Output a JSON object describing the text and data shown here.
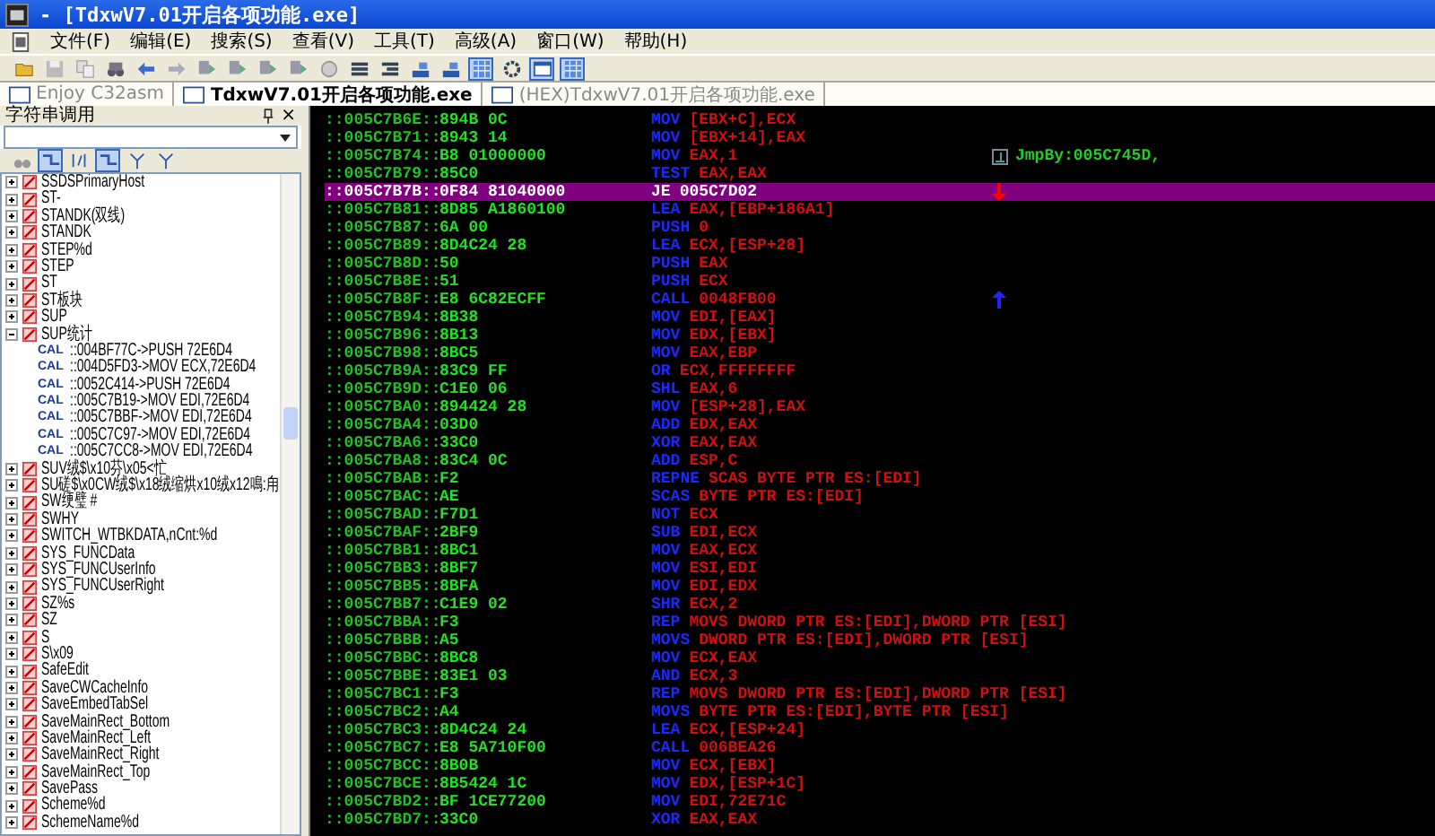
{
  "window": {
    "title": "- [TdxwV7.01开启各项功能.exe]"
  },
  "menu": [
    "文件(F)",
    "编辑(E)",
    "搜索(S)",
    "查看(V)",
    "工具(T)",
    "高级(A)",
    "窗口(W)",
    "帮助(H)"
  ],
  "toolbar": [
    {
      "pressed": false
    },
    {
      "pressed": false
    },
    {
      "pressed": false
    },
    {
      "pressed": false
    },
    {
      "pressed": false
    },
    {
      "pressed": false
    },
    {
      "pressed": false
    },
    {
      "pressed": false
    },
    {
      "pressed": false
    },
    {
      "pressed": false
    },
    {
      "pressed": false
    },
    {
      "pressed": false
    },
    {
      "pressed": false
    },
    {
      "pressed": false
    },
    {
      "pressed": false
    },
    {
      "pressed": true
    },
    {
      "pressed": false
    },
    {
      "pressed": true
    },
    {
      "pressed": true
    }
  ],
  "tabs": [
    {
      "label": "Enjoy C32asm",
      "selected": false
    },
    {
      "label": "TdxwV7.01开启各项功能.exe",
      "selected": true
    },
    {
      "label": "(HEX)TdxwV7.01开启各项功能.exe",
      "selected": false
    }
  ],
  "string_panel": {
    "title": "字符串调用",
    "close": "×",
    "filter_toolbar": [
      {
        "pressed": false
      },
      {
        "pressed": true
      },
      {
        "pressed": false
      },
      {
        "pressed": true
      },
      {
        "pressed": false
      },
      {
        "pressed": false
      }
    ],
    "items": [
      {
        "label": "SSDSPrimaryHost",
        "expanded": false
      },
      {
        "label": "ST-",
        "expanded": false
      },
      {
        "label": "STANDK(双线)",
        "expanded": false
      },
      {
        "label": "STANDK",
        "expanded": false
      },
      {
        "label": "STEP%d",
        "expanded": false
      },
      {
        "label": "STEP",
        "expanded": false
      },
      {
        "label": "ST",
        "expanded": false
      },
      {
        "label": "ST板块",
        "expanded": false
      },
      {
        "label": "SUP",
        "expanded": false
      },
      {
        "label": "SUP统计",
        "expanded": true,
        "children": [
          {
            "tag": "CAL",
            "label": "::004BF77C->PUSH 72E6D4"
          },
          {
            "tag": "CAL",
            "label": "::004D5FD3->MOV ECX,72E6D4"
          },
          {
            "tag": "CAL",
            "label": "::0052C414->PUSH 72E6D4"
          },
          {
            "tag": "CAL",
            "label": "::005C7B19->MOV EDI,72E6D4"
          },
          {
            "tag": "CAL",
            "label": "::005C7BBF->MOV EDI,72E6D4"
          },
          {
            "tag": "CAL",
            "label": "::005C7C97->MOV EDI,72E6D4"
          },
          {
            "tag": "CAL",
            "label": "::005C7CC8->MOV EDI,72E6D4"
          }
        ]
      },
      {
        "label": "SUV绒$\\x10芬\\x05<忙",
        "expanded": false
      },
      {
        "label": "SU磋$\\x0CW绒$\\x18绒缩烘x10绒x12鳴:甪",
        "expanded": false
      },
      {
        "label": "SW绠璧 #",
        "expanded": false
      },
      {
        "label": "SWHY",
        "expanded": false
      },
      {
        "label": "SWITCH_WTBKDATA,nCnt:%d",
        "expanded": false
      },
      {
        "label": "SYS_FUNCData",
        "expanded": false
      },
      {
        "label": "SYS_FUNCUserInfo",
        "expanded": false
      },
      {
        "label": "SYS_FUNCUserRight",
        "expanded": false
      },
      {
        "label": "SZ%s",
        "expanded": false
      },
      {
        "label": "SZ",
        "expanded": false
      },
      {
        "label": "S",
        "expanded": false
      },
      {
        "label": "S\\x09",
        "expanded": false
      },
      {
        "label": "SafeEdit",
        "expanded": false
      },
      {
        "label": "SaveCWCacheInfo",
        "expanded": false
      },
      {
        "label": "SaveEmbedTabSel",
        "expanded": false
      },
      {
        "label": "SaveMainRect_Bottom",
        "expanded": false
      },
      {
        "label": "SaveMainRect_Left",
        "expanded": false
      },
      {
        "label": "SaveMainRect_Right",
        "expanded": false
      },
      {
        "label": "SaveMainRect_Top",
        "expanded": false
      },
      {
        "label": "SavePass",
        "expanded": false
      },
      {
        "label": "Scheme%d",
        "expanded": false
      },
      {
        "label": "SchemeName%d",
        "expanded": false
      }
    ]
  },
  "disassembly": {
    "rows": [
      {
        "address": "::005C7B6E::",
        "bytes": "894B 0C",
        "mnemonic": "MOV",
        "operands": "[EBX+C],ECX",
        "selected": false
      },
      {
        "address": "::005C7B71::",
        "bytes": "8943 14",
        "mnemonic": "MOV",
        "operands": "[EBX+14],EAX",
        "selected": false
      },
      {
        "address": "::005C7B74::",
        "bytes": "B8 01000000",
        "mnemonic": "MOV",
        "operands": "EAX,1",
        "selected": false,
        "note": "JmpBy:005C745D,"
      },
      {
        "address": "::005C7B79::",
        "bytes": "85C0",
        "mnemonic": "TEST",
        "operands": "EAX,EAX",
        "selected": false
      },
      {
        "address": "::005C7B7B::",
        "bytes": "0F84 81040000",
        "mnemonic": "JE",
        "operands": "005C7D02",
        "selected": true,
        "jump_arrow": {
          "points_down": true,
          "color": "#ff0000"
        }
      },
      {
        "address": "::005C7B81::",
        "bytes": "8D85 A1860100",
        "mnemonic": "LEA",
        "operands": "EAX,[EBP+186A1]",
        "selected": false
      },
      {
        "address": "::005C7B87::",
        "bytes": "6A 00",
        "mnemonic": "PUSH",
        "operands": "0",
        "selected": false
      },
      {
        "address": "::005C7B89::",
        "bytes": "8D4C24 28",
        "mnemonic": "LEA",
        "operands": "ECX,[ESP+28]",
        "selected": false
      },
      {
        "address": "::005C7B8D::",
        "bytes": "50",
        "mnemonic": "PUSH",
        "operands": "EAX",
        "selected": false
      },
      {
        "address": "::005C7B8E::",
        "bytes": "51",
        "mnemonic": "PUSH",
        "operands": "ECX",
        "selected": false
      },
      {
        "address": "::005C7B8F::",
        "bytes": "E8 6C82ECFF",
        "mnemonic": "CALL",
        "operands": "0048FB00",
        "selected": false,
        "jump_arrow": {
          "points_down": false,
          "color": "#2222ff"
        }
      },
      {
        "address": "::005C7B94::",
        "bytes": "8B38",
        "mnemonic": "MOV",
        "operands": "EDI,[EAX]",
        "selected": false
      },
      {
        "address": "::005C7B96::",
        "bytes": "8B13",
        "mnemonic": "MOV",
        "operands": "EDX,[EBX]",
        "selected": false
      },
      {
        "address": "::005C7B98::",
        "bytes": "8BC5",
        "mnemonic": "MOV",
        "operands": "EAX,EBP",
        "selected": false
      },
      {
        "address": "::005C7B9A::",
        "bytes": "83C9 FF",
        "mnemonic": "OR",
        "operands": "ECX,FFFFFFFF",
        "selected": false
      },
      {
        "address": "::005C7B9D::",
        "bytes": "C1E0 06",
        "mnemonic": "SHL",
        "operands": "EAX,6",
        "selected": false
      },
      {
        "address": "::005C7BA0::",
        "bytes": "894424 28",
        "mnemonic": "MOV",
        "operands": "[ESP+28],EAX",
        "selected": false
      },
      {
        "address": "::005C7BA4::",
        "bytes": "03D0",
        "mnemonic": "ADD",
        "operands": "EDX,EAX",
        "selected": false
      },
      {
        "address": "::005C7BA6::",
        "bytes": "33C0",
        "mnemonic": "XOR",
        "operands": "EAX,EAX",
        "selected": false
      },
      {
        "address": "::005C7BA8::",
        "bytes": "83C4 0C",
        "mnemonic": "ADD",
        "operands": "ESP,C",
        "selected": false
      },
      {
        "address": "::005C7BAB::",
        "bytes": "F2",
        "mnemonic": "REPNE",
        "operands": "SCAS BYTE PTR ES:[EDI]",
        "selected": false
      },
      {
        "address": "::005C7BAC::",
        "bytes": "AE",
        "mnemonic": "SCAS",
        "operands": "BYTE PTR ES:[EDI]",
        "selected": false
      },
      {
        "address": "::005C7BAD::",
        "bytes": "F7D1",
        "mnemonic": "NOT",
        "operands": "ECX",
        "selected": false
      },
      {
        "address": "::005C7BAF::",
        "bytes": "2BF9",
        "mnemonic": "SUB",
        "operands": "EDI,ECX",
        "selected": false
      },
      {
        "address": "::005C7BB1::",
        "bytes": "8BC1",
        "mnemonic": "MOV",
        "operands": "EAX,ECX",
        "selected": false
      },
      {
        "address": "::005C7BB3::",
        "bytes": "8BF7",
        "mnemonic": "MOV",
        "operands": "ESI,EDI",
        "selected": false
      },
      {
        "address": "::005C7BB5::",
        "bytes": "8BFA",
        "mnemonic": "MOV",
        "operands": "EDI,EDX",
        "selected": false
      },
      {
        "address": "::005C7BB7::",
        "bytes": "C1E9 02",
        "mnemonic": "SHR",
        "operands": "ECX,2",
        "selected": false
      },
      {
        "address": "::005C7BBA::",
        "bytes": "F3",
        "mnemonic": "REP",
        "operands": "MOVS DWORD PTR ES:[EDI],DWORD PTR [ESI]",
        "selected": false
      },
      {
        "address": "::005C7BBB::",
        "bytes": "A5",
        "mnemonic": "MOVS",
        "operands": "DWORD PTR ES:[EDI],DWORD PTR [ESI]",
        "selected": false
      },
      {
        "address": "::005C7BBC::",
        "bytes": "8BC8",
        "mnemonic": "MOV",
        "operands": "ECX,EAX",
        "selected": false
      },
      {
        "address": "::005C7BBE::",
        "bytes": "83E1 03",
        "mnemonic": "AND",
        "operands": "ECX,3",
        "selected": false
      },
      {
        "address": "::005C7BC1::",
        "bytes": "F3",
        "mnemonic": "REP",
        "operands": "MOVS DWORD PTR ES:[EDI],DWORD PTR [ESI]",
        "selected": false
      },
      {
        "address": "::005C7BC2::",
        "bytes": "A4",
        "mnemonic": "MOVS",
        "operands": "BYTE PTR ES:[EDI],BYTE PTR [ESI]",
        "selected": false
      },
      {
        "address": "::005C7BC3::",
        "bytes": "8D4C24 24",
        "mnemonic": "LEA",
        "operands": "ECX,[ESP+24]",
        "selected": false
      },
      {
        "address": "::005C7BC7::",
        "bytes": "E8 5A710F00",
        "mnemonic": "CALL",
        "operands": "006BEA26",
        "selected": false
      },
      {
        "address": "::005C7BCC::",
        "bytes": "8B0B",
        "mnemonic": "MOV",
        "operands": "ECX,[EBX]",
        "selected": false
      },
      {
        "address": "::005C7BCE::",
        "bytes": "8B5424 1C",
        "mnemonic": "MOV",
        "operands": "EDX,[ESP+1C]",
        "selected": false
      },
      {
        "address": "::005C7BD2::",
        "bytes": "BF 1CE77200",
        "mnemonic": "MOV",
        "operands": "EDI,72E71C",
        "selected": false
      },
      {
        "address": "::005C7BD7::",
        "bytes": "33C0",
        "mnemonic": "XOR",
        "operands": "EAX,EAX",
        "selected": false
      }
    ]
  }
}
